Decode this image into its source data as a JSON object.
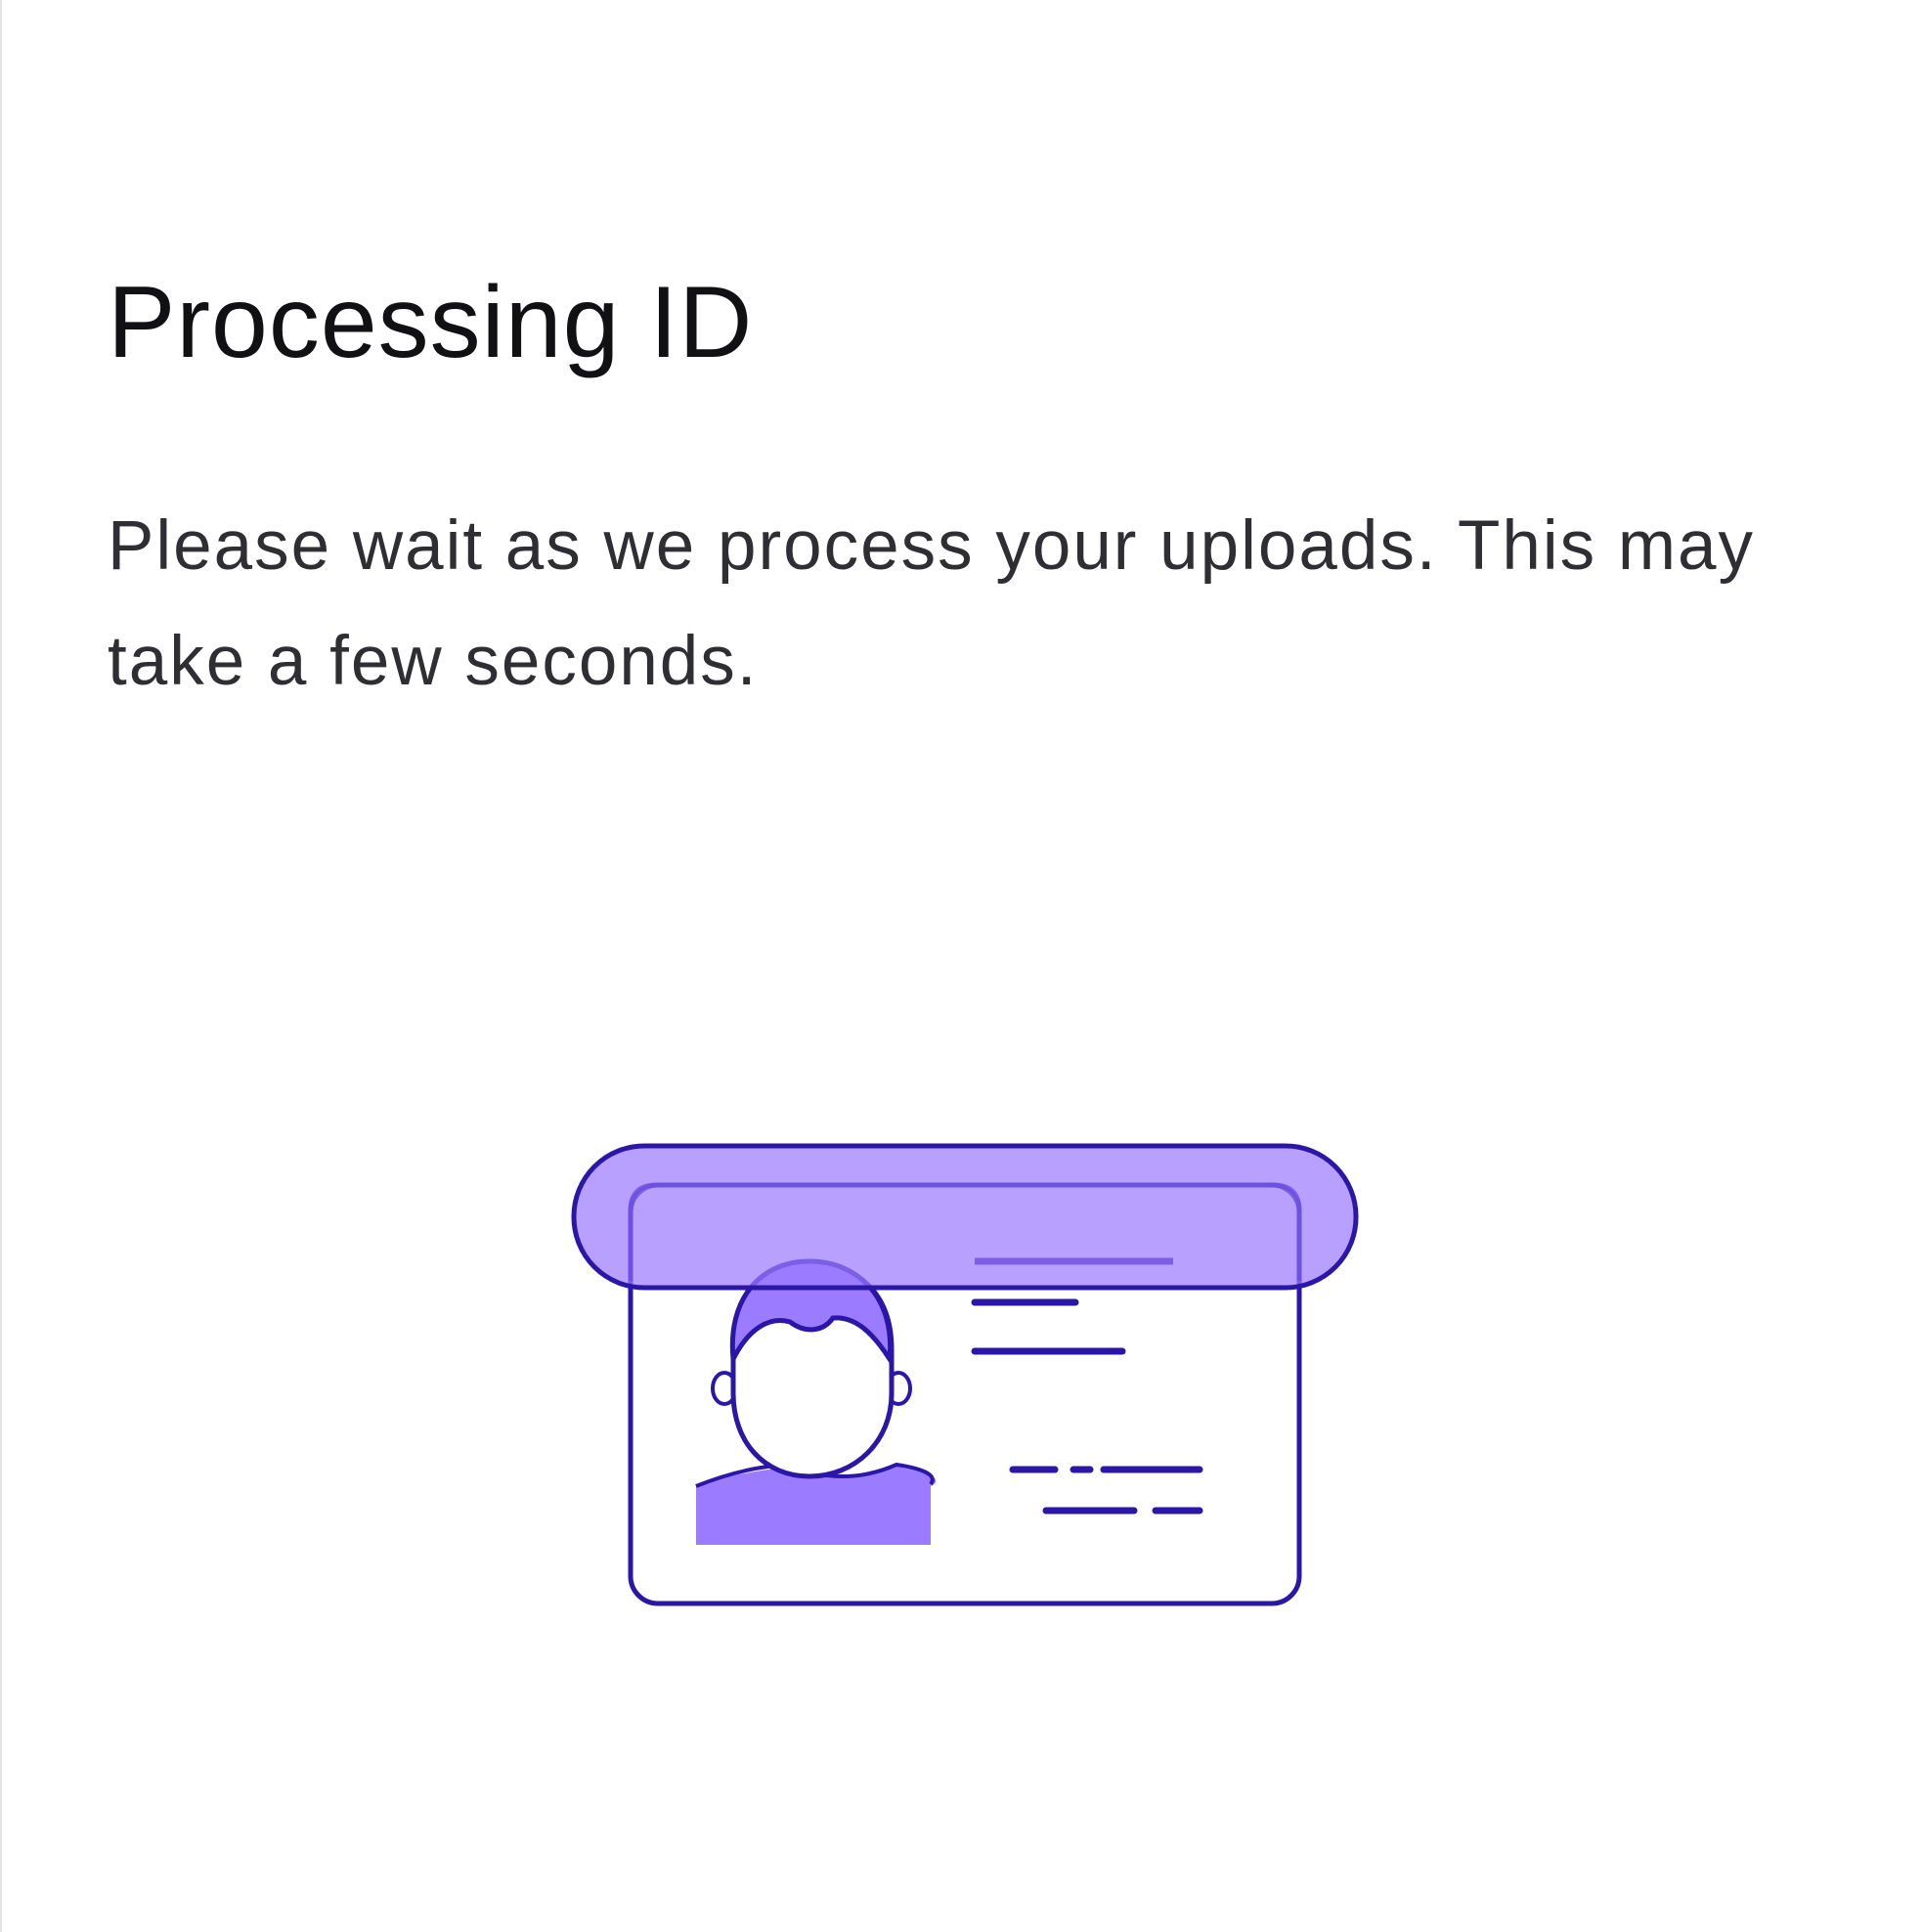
{
  "screen": {
    "title": "Processing ID",
    "message": "Please wait as we process your uploads. This may take a few seconds."
  },
  "illustration": {
    "icon": "id-card-scan-icon",
    "colors": {
      "stroke": "#2a17a8",
      "fill_light": "#ab93fb",
      "fill_dark": "#9b7bff"
    }
  }
}
